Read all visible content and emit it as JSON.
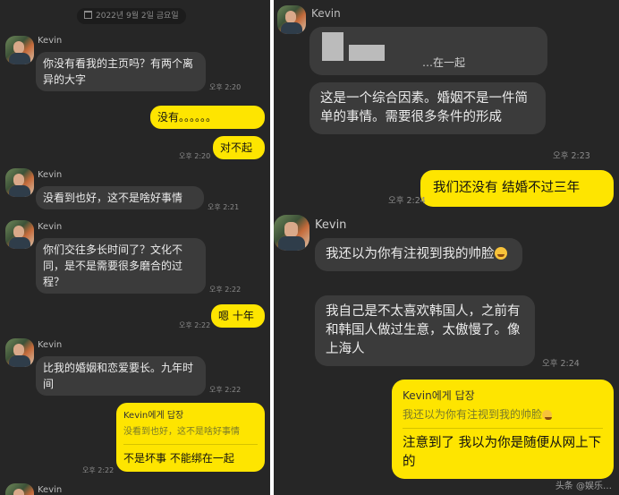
{
  "left": {
    "date": "2022년 9월 2일 금요일",
    "sender": "Kevin",
    "messages": [
      {
        "text": "你没有看我的主页吗？有两个离异的大字",
        "time": "오후 2:20"
      },
      {
        "text": "没有。。。。。。",
        "time": ""
      },
      {
        "text": "对不起",
        "time": "오후 2:20"
      },
      {
        "text": "没看到也好，这不是啥好事情",
        "time": "오후 2:21"
      },
      {
        "text": "你们交往多长时间了？文化不同，是不是需要很多磨合的过程？",
        "time": "오후 2:22"
      },
      {
        "text": "嗯 十年",
        "time": "오후 2:22"
      },
      {
        "text": "比我的婚姻和恋爱要长。九年时间",
        "time": "오후 2:22"
      },
      {
        "reply_name": "Kevin에게 답장",
        "reply_quote": "没看到也好，这不是啥好事情",
        "text": "不是坏事 不能绑在一起",
        "time": "오후 2:22"
      }
    ]
  },
  "right": {
    "sender": "Kevin",
    "messages": [
      {
        "text": "…在一起",
        "time": ""
      },
      {
        "text": "这是一个综合因素。婚姻不是一件简单的事情。需要很多条件的形成",
        "time": "오후 2:23"
      },
      {
        "text": "我们还没有 结婚不过三年",
        "time": "오후 2:24"
      },
      {
        "text": "我还以为你有注视到我的帅脸",
        "time": ""
      },
      {
        "text": "我自己是不太喜欢韩国人，之前有和韩国人做过生意，太傲慢了。像上海人",
        "time": "오후 2:24"
      },
      {
        "reply_name": "Kevin에게 답장",
        "reply_quote": "我还以为你有注视到我的帅脸",
        "text": "注意到了 我以为你是随便从网上下的",
        "time": ""
      }
    ]
  },
  "watermark": "头条 @娱乐…",
  "colors": {
    "background": "#262626",
    "incoming": "#3b3b3b",
    "outgoing": "#fee500"
  }
}
